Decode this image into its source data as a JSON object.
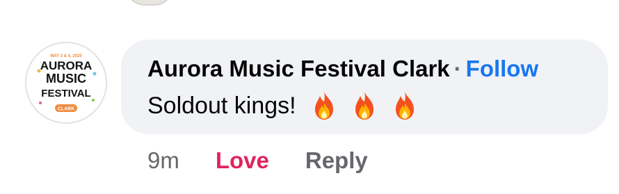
{
  "comment": {
    "author": "Aurora Music Festival Clark",
    "separator": "·",
    "follow_label": "Follow",
    "text": "Soldout kings!",
    "emojis": [
      "fire-icon",
      "fire-icon",
      "fire-icon"
    ]
  },
  "avatar": {
    "logo_top": "MAY 3 & 4, 2025",
    "logo_line1": "AURORA",
    "logo_line2": "MUSIC",
    "logo_line3": "FESTIVAL",
    "logo_badge": "CLARK"
  },
  "actions": {
    "time": "9m",
    "love_label": "Love",
    "reply_label": "Reply"
  },
  "colors": {
    "bubble": "#f0f2f5",
    "follow": "#1877f2",
    "love": "#e0245e",
    "muted": "#65676b",
    "logo_orange": "#f08a3c"
  }
}
